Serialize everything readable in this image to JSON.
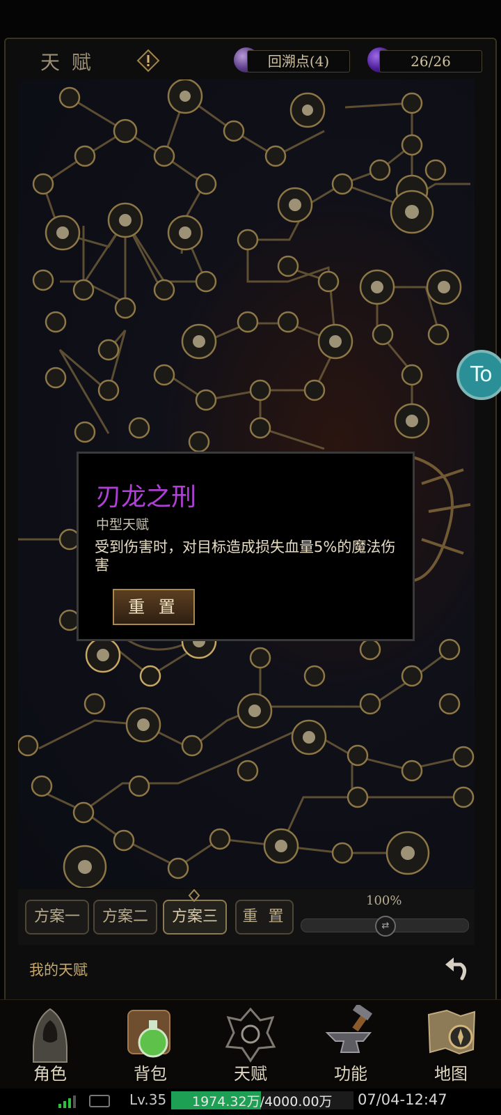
{
  "header": {
    "title": "天 赋",
    "points_label": "回溯点(4)",
    "capacity": "26/26"
  },
  "tooltip": {
    "name": "刃龙之刑",
    "type": "中型天赋",
    "description": "受到伤害时，对目标造成损失血量5%的魔法伤害",
    "reset_label": "重 置"
  },
  "plans": {
    "items": [
      "方案一",
      "方案二",
      "方案三"
    ],
    "active_index": 2,
    "reset_label": "重 置",
    "zoom": "100%"
  },
  "footer": {
    "my_talent": "我的天赋"
  },
  "nav": {
    "items": [
      {
        "label": "角色",
        "icon": "hooded-character-icon"
      },
      {
        "label": "背包",
        "icon": "backpack-potion-icon"
      },
      {
        "label": "天赋",
        "icon": "dragon-crest-icon"
      },
      {
        "label": "功能",
        "icon": "anvil-hammer-icon"
      },
      {
        "label": "地图",
        "icon": "map-compass-icon"
      }
    ]
  },
  "status": {
    "level": "Lv.35",
    "xp": "1974.32万/4000.00万",
    "xp_fraction": 0.4936,
    "datetime": "07/04-12:47"
  },
  "side_button_text": "To",
  "colors": {
    "accent_gold": "#c6a86a",
    "talent_name_purple": "#b040d8",
    "xp_green": "#1ea054"
  }
}
